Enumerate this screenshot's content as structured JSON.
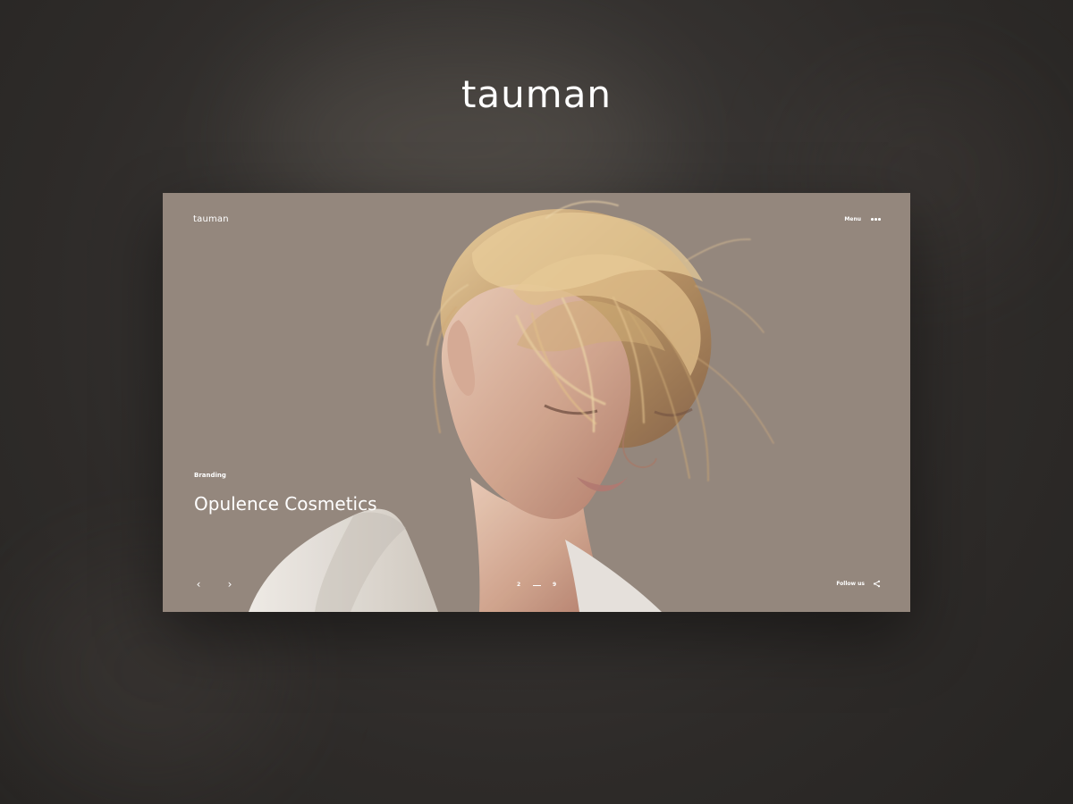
{
  "header": {
    "brand": "tauman"
  },
  "preview": {
    "logo": "tauman",
    "menu_label": "Menu",
    "menu_icon": "more-horizontal-icon",
    "category": "Branding",
    "title": "Opulence Cosmetics",
    "prev_icon": "chevron-left-icon",
    "next_icon": "chevron-right-icon",
    "prev_symbol": "‹",
    "next_symbol": "›",
    "pagination": {
      "current": "2",
      "total": "9"
    },
    "follow_label": "Follow us",
    "share_icon": "share-icon"
  },
  "colors": {
    "page_background": "#2c2a28",
    "preview_background": "#988a80",
    "text": "#ffffff"
  }
}
